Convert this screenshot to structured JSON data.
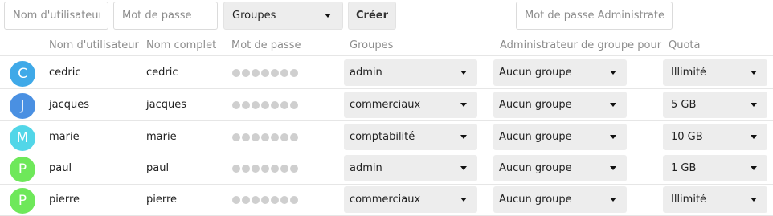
{
  "form": {
    "username_placeholder": "Nom d'utilisateur",
    "password_placeholder": "Mot de passe",
    "groups_select": "Groupes",
    "create_label": "Créer",
    "admin_password_placeholder": "Mot de passe Administrateur"
  },
  "table": {
    "headers": {
      "username": "Nom d'utilisateur",
      "fullname": "Nom complet",
      "password": "Mot de passe",
      "groups": "Groupes",
      "group_admin": "Administrateur de groupe pour",
      "quota": "Quota"
    },
    "rows": [
      {
        "initial": "C",
        "avatar_color": "#3fa9e8",
        "username": "cedric",
        "fullname": "cedric",
        "group": "admin",
        "group_admin": "Aucun groupe",
        "quota": "Illimité"
      },
      {
        "initial": "J",
        "avatar_color": "#4a90e2",
        "username": "jacques",
        "fullname": "jacques",
        "group": "commerciaux",
        "group_admin": "Aucun groupe",
        "quota": "5 GB"
      },
      {
        "initial": "M",
        "avatar_color": "#52d6e8",
        "username": "marie",
        "fullname": "marie",
        "group": "comptabilité",
        "group_admin": "Aucun groupe",
        "quota": "10 GB"
      },
      {
        "initial": "P",
        "avatar_color": "#6ee85a",
        "username": "paul",
        "fullname": "paul",
        "group": "admin",
        "group_admin": "Aucun groupe",
        "quota": "1 GB"
      },
      {
        "initial": "P",
        "avatar_color": "#6ee85a",
        "username": "pierre",
        "fullname": "pierre",
        "group": "commerciaux",
        "group_admin": "Aucun groupe",
        "quota": "Illimité"
      }
    ]
  }
}
